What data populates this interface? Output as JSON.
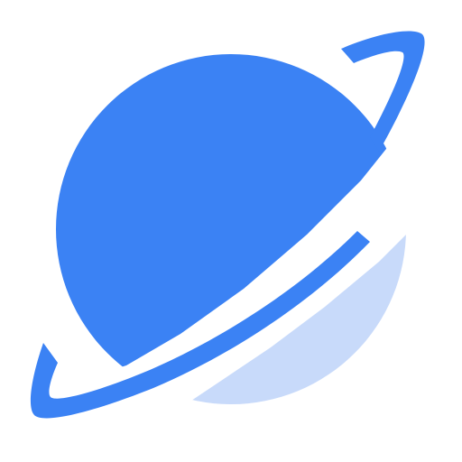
{
  "icon": {
    "name": "planet-icon",
    "colors": {
      "background": "#ffffff",
      "planet": "#3b82f4",
      "planet_shadow": "#c8dafa",
      "ring": "#3b82f4"
    }
  }
}
